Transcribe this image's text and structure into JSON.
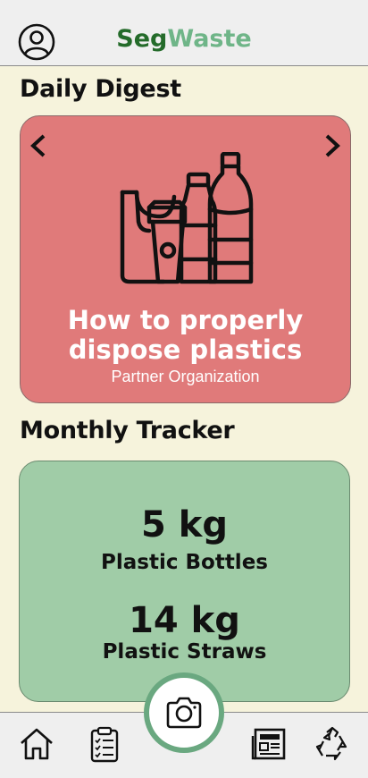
{
  "app": {
    "brand_part1": "Seg",
    "brand_part2": "Waste"
  },
  "colors": {
    "brand_dark": "#246b2a",
    "brand_light": "#6fb588",
    "digest_card": "#e07a7a",
    "tracker_card": "#a0cca7",
    "background": "#f6f3dc",
    "camera_ring": "#6aa880"
  },
  "daily_digest": {
    "section_title": "Daily Digest",
    "card": {
      "title_line1": "How to properly",
      "title_line2": "dispose plastics",
      "subtitle": "Partner Organization",
      "illustration": "plastic-waste-icon"
    }
  },
  "monthly_tracker": {
    "section_title": "Monthly Tracker",
    "items": [
      {
        "value": "5 kg",
        "label": "Plastic Bottles"
      },
      {
        "value": "14 kg",
        "label": "Plastic Straws"
      }
    ]
  },
  "nav": {
    "icons": [
      "home-icon",
      "clipboard-icon",
      "camera-icon",
      "newspaper-icon",
      "recycle-icon"
    ]
  }
}
